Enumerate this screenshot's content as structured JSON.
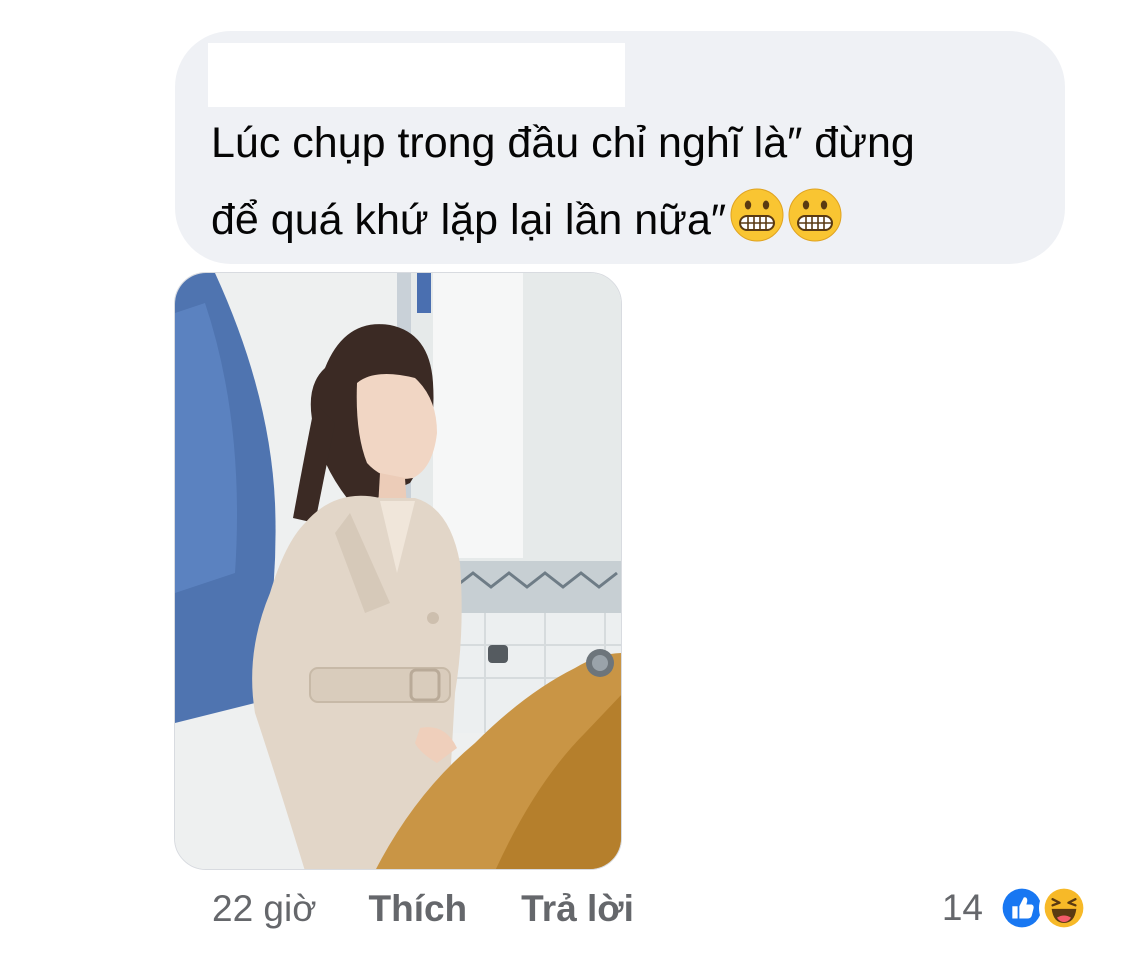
{
  "comment": {
    "author_name": "",
    "text_line1": "Lúc chụp trong đầu chỉ nghĩ là″  đừng",
    "text_line2": "để quá khứ lặp lại lần nữa″",
    "emojis": [
      "grimacing-face",
      "grimacing-face"
    ]
  },
  "photo": {
    "description_icon": "photo-attachment"
  },
  "actions": {
    "time": "22 giờ",
    "like_label": "Thích",
    "reply_label": "Trả lời"
  },
  "reactions": {
    "count": "14",
    "types": [
      "like",
      "haha"
    ],
    "colors": {
      "like": "#1877f2",
      "haha": "#f7b928"
    }
  }
}
